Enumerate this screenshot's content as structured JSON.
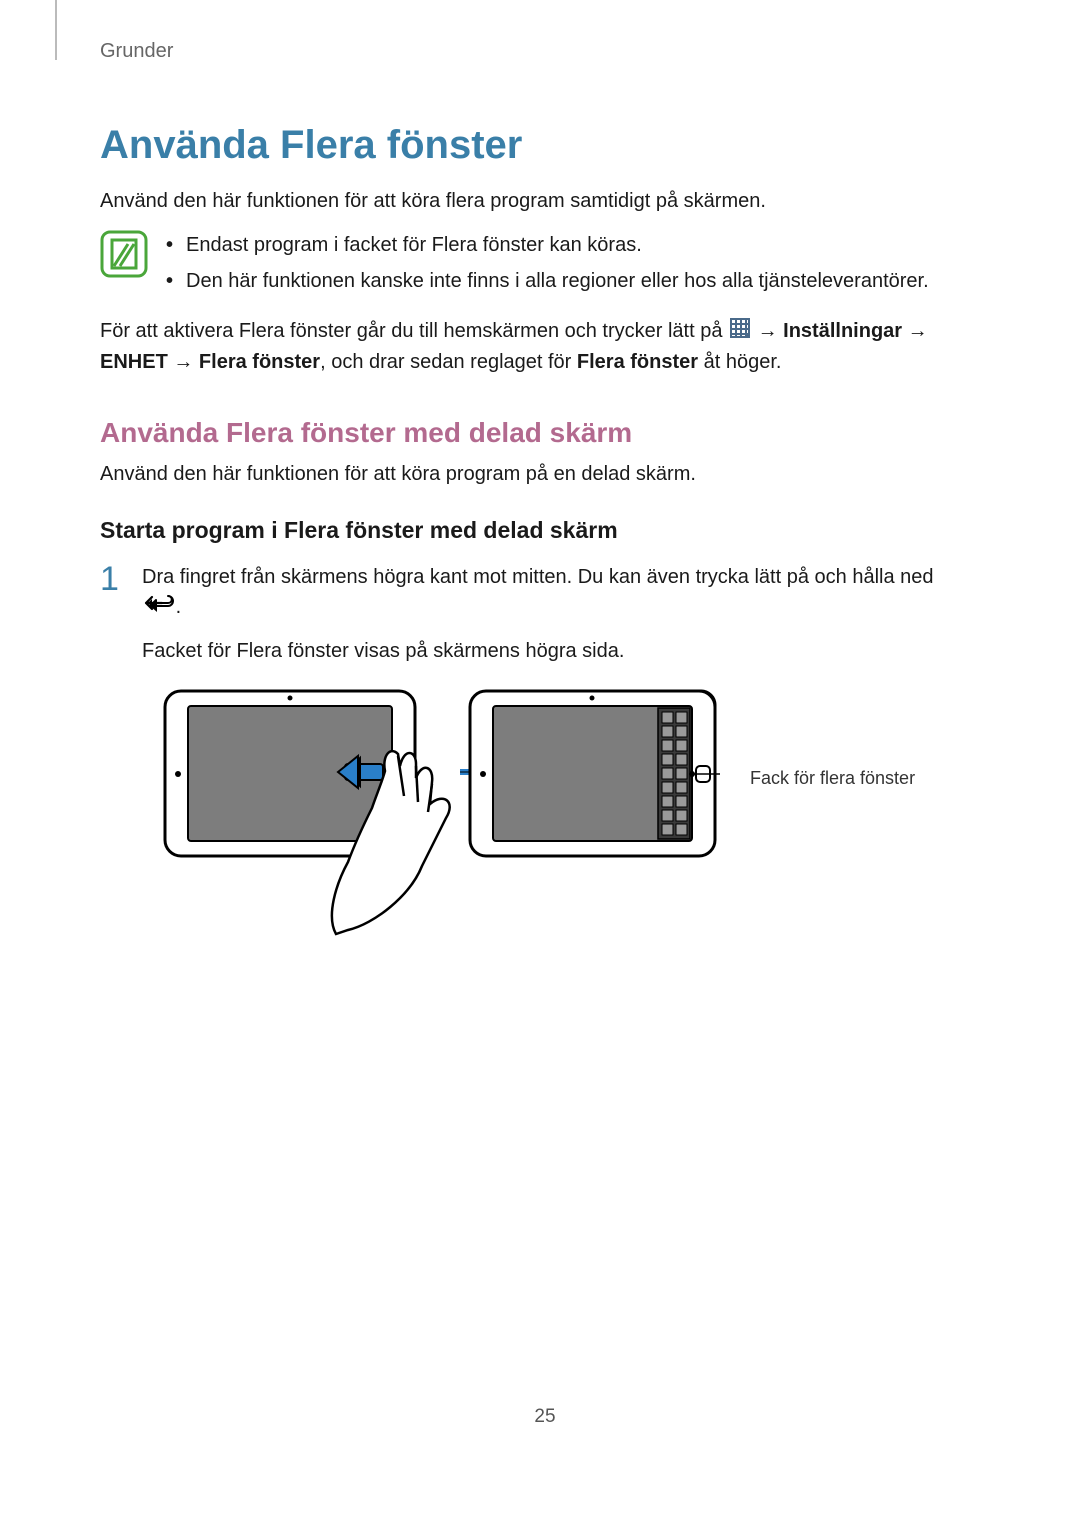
{
  "header": {
    "section": "Grunder"
  },
  "h1": "Använda Flera fönster",
  "intro": "Använd den här funktionen för att köra flera program samtidigt på skärmen.",
  "note_items": [
    "Endast program i facket för Flera fönster kan köras.",
    "Den här funktionen kanske inte finns i alla regioner eller hos alla tjänsteleverantörer."
  ],
  "activate": {
    "pre": "För att aktivera Flera fönster går du till hemskärmen och trycker lätt på ",
    "arrow": "→",
    "settings": "Inställningar",
    "enhet": "ENHET",
    "flera": "Flera fönster",
    "mid": ", och drar sedan reglaget för ",
    "flera2": "Flera fönster",
    "end": " åt höger."
  },
  "h2": "Använda Flera fönster med delad skärm",
  "h2_intro": "Använd den här funktionen för att köra program på en delad skärm.",
  "h3": "Starta program i Flera fönster med delad skärm",
  "step1": {
    "num": "1",
    "line1": "Dra fingret från skärmens högra kant mot mitten. Du kan även trycka lätt på och hålla ned ",
    "period": ".",
    "line2": "Facket för Flera fönster visas på skärmens högra sida."
  },
  "callout": "Fack för flera fönster",
  "pagenum": "25"
}
